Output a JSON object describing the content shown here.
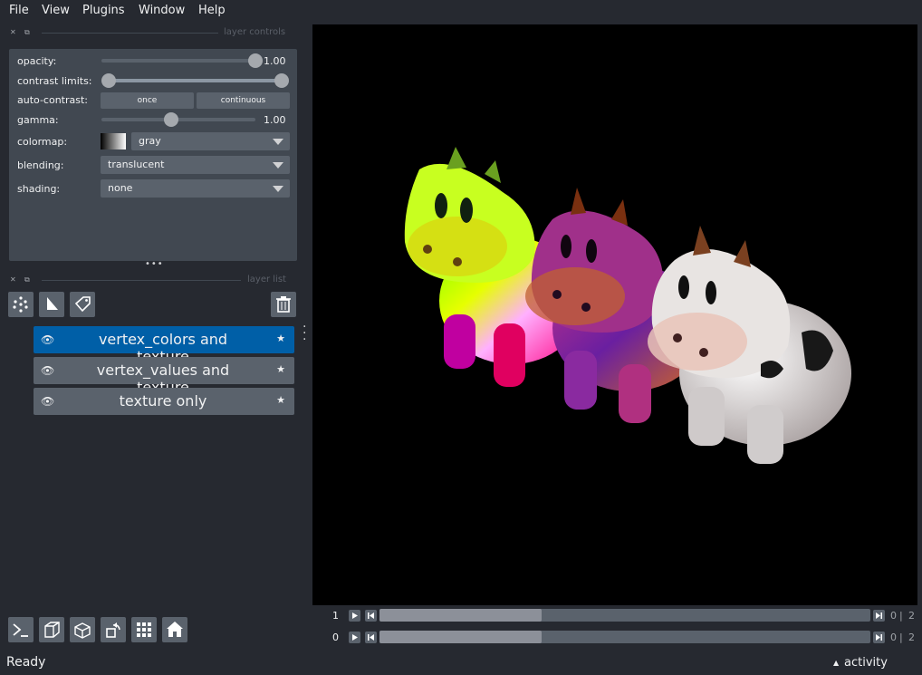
{
  "menu": [
    "File",
    "View",
    "Plugins",
    "Window",
    "Help"
  ],
  "panels": {
    "controls_title": "layer controls",
    "list_title": "layer list"
  },
  "controls": {
    "opacity_label": "opacity:",
    "opacity_value": "1.00",
    "opacity_level": 1.0,
    "contrast_label": "contrast limits:",
    "contrast_range": [
      0,
      1
    ],
    "autocontrast_label": "auto-contrast:",
    "once_label": "once",
    "continuous_label": "continuous",
    "gamma_label": "gamma:",
    "gamma_value": "1.00",
    "colormap_label": "colormap:",
    "colormap_value": "gray",
    "blending_label": "blending:",
    "blending_value": "translucent",
    "shading_label": "shading:",
    "shading_value": "none"
  },
  "layers": [
    {
      "name": "vertex_colors and texture",
      "selected": true
    },
    {
      "name": "vertex_values and texture",
      "selected": false
    },
    {
      "name": "texture only",
      "selected": false
    }
  ],
  "dims": [
    {
      "label": "1",
      "current": "0",
      "max": "2",
      "fraction": 0.33
    },
    {
      "label": "0",
      "current": "0",
      "max": "2",
      "fraction": 0.33
    }
  ],
  "status": "Ready",
  "activity": "activity",
  "colors": {
    "selected": "#005fa7",
    "bg": "#262930",
    "panel": "#414851"
  },
  "icons": [
    "points-icon",
    "shapes-icon",
    "labels-icon",
    "delete-icon",
    "console-icon",
    "ndisplay-icon",
    "roll-icon",
    "transpose-icon",
    "grid-icon",
    "home-icon"
  ]
}
